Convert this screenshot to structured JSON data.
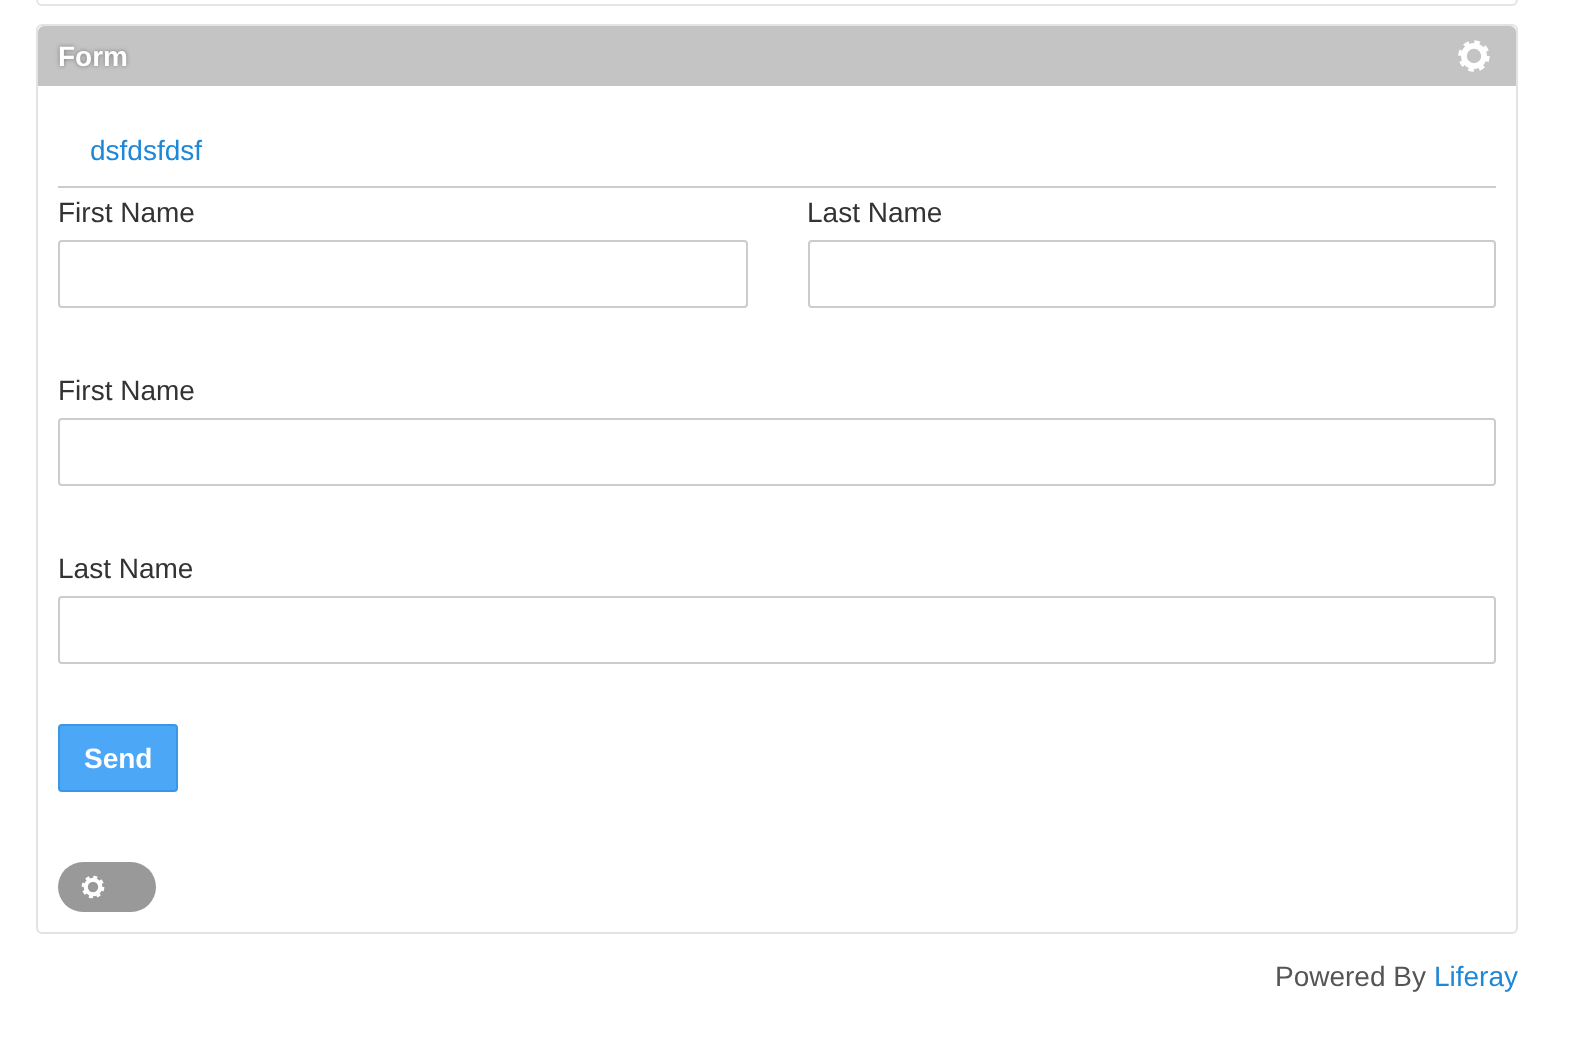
{
  "portlet": {
    "title": "Form",
    "form_title": "dsfdsfdsf",
    "rows": [
      [
        {
          "label": "First Name"
        },
        {
          "label": "Last Name"
        }
      ],
      [
        {
          "label": "First Name"
        }
      ],
      [
        {
          "label": "Last Name"
        }
      ]
    ],
    "submit": "Send",
    "settings_toggle": {
      "on": false
    }
  },
  "footer": {
    "text": "Powered By",
    "link": "Liferay"
  }
}
